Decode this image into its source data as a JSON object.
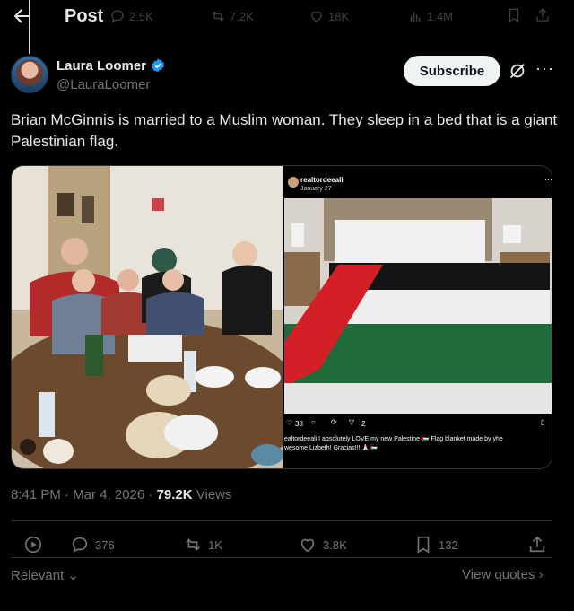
{
  "header": {
    "title": "Post",
    "ghost_stats": {
      "replies": "2.5K",
      "reposts": "7.2K",
      "likes": "18K",
      "views": "1.4M"
    }
  },
  "author": {
    "name": "Laura Loomer",
    "handle": "@LauraLoomer",
    "subscribe_label": "Subscribe",
    "more": "···"
  },
  "tweet": {
    "text": "Brian McGinnis is married to a Muslim woman. They sleep in a bed that is a giant Palestinian flag."
  },
  "instagram": {
    "user": "realtordeeali",
    "date": "January 27",
    "likes": "38",
    "shares": "2",
    "caption_line1": "ealtordeeali I absolutely LOVE my new Palestine 🇵🇸 Flag blanket made by yhe",
    "caption_line2": "wesome Lizbeth!  Gracias!!! 🙏🏻🇵🇸"
  },
  "meta": {
    "time": "8:41 PM · Mar 4, 2026 · ",
    "views_count": "79.2K",
    "views_label": " Views"
  },
  "actions": {
    "replies": "376",
    "reposts": "1K",
    "likes": "3.8K",
    "bookmarks": "132"
  },
  "footer": {
    "relevant": "Relevant",
    "view_quotes": "View quotes"
  },
  "colors": {
    "background": "#000000",
    "text": "#e7e9ea",
    "muted": "#71767b",
    "border": "#2f3336",
    "verified": "#1d9bf0",
    "flag_red": "#d32027",
    "flag_green": "#1f6b3a"
  }
}
